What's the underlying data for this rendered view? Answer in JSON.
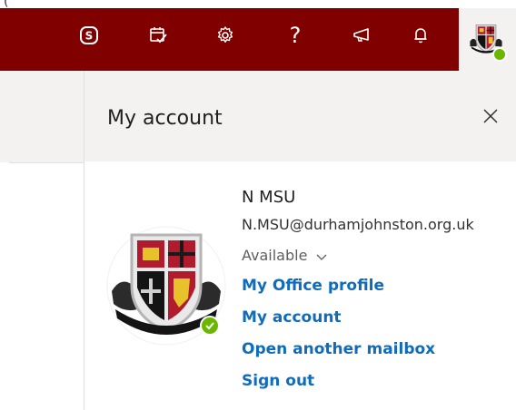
{
  "top_strip": {
    "peek_text": "("
  },
  "header": {
    "bg_color": "#800000",
    "icons": [
      "skype-icon",
      "calendar-check-icon",
      "settings-gear-icon",
      "help-icon",
      "megaphone-icon",
      "bell-icon"
    ],
    "help_glyph": "?"
  },
  "account_panel": {
    "title": "My account",
    "close_icon": "close-icon",
    "user": {
      "name": "N MSU",
      "email": "N.MSU@durhamjohnston.org.uk",
      "status": "Available",
      "status_color": "#6bb700"
    },
    "links": [
      "My Office profile",
      "My account",
      "Open another mailbox",
      "Sign out"
    ],
    "link_color": "#0f6cbd"
  }
}
